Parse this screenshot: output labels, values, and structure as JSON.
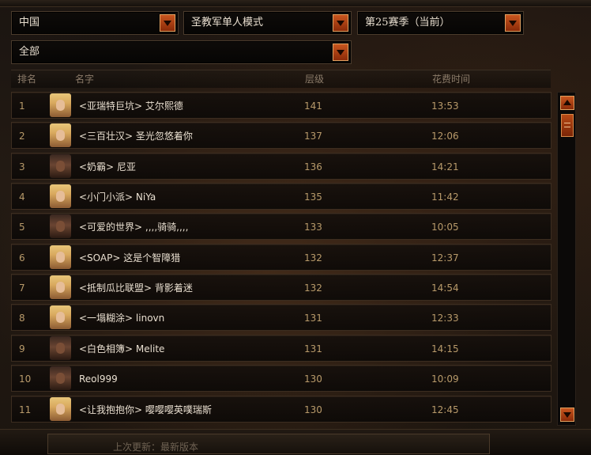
{
  "filters": {
    "region": "中国",
    "mode": "圣教军单人模式",
    "season": "第25赛季（当前）",
    "category": "全部"
  },
  "table": {
    "columns": [
      "排名",
      "名字",
      "层级",
      "花费时间"
    ],
    "rows": [
      {
        "rank": "1",
        "name": "<亚瑞特巨坑> 艾尔熙德",
        "level": "141",
        "time": "13:53",
        "portrait": "female"
      },
      {
        "rank": "2",
        "name": "<三百壮汉> 圣光忽悠着你",
        "level": "137",
        "time": "12:06",
        "portrait": "female"
      },
      {
        "rank": "3",
        "name": "<奶霸> 尼亚",
        "level": "136",
        "time": "14:21",
        "portrait": "male"
      },
      {
        "rank": "4",
        "name": "<小门小派> NiYa",
        "level": "135",
        "time": "11:42",
        "portrait": "female"
      },
      {
        "rank": "5",
        "name": "<可爱的世界> ,,,,骑骑,,,,",
        "level": "133",
        "time": "10:05",
        "portrait": "male"
      },
      {
        "rank": "6",
        "name": "<SOAP> 这是个智障猎",
        "level": "132",
        "time": "12:37",
        "portrait": "female"
      },
      {
        "rank": "7",
        "name": "<抵制瓜比联盟> 背影着迷",
        "level": "132",
        "time": "14:54",
        "portrait": "female"
      },
      {
        "rank": "8",
        "name": "<一塌糊涂> linovn",
        "level": "131",
        "time": "12:33",
        "portrait": "female"
      },
      {
        "rank": "9",
        "name": "<白色相簿> Melite",
        "level": "131",
        "time": "14:15",
        "portrait": "male"
      },
      {
        "rank": "10",
        "name": "Reol999",
        "level": "130",
        "time": "10:09",
        "portrait": "male"
      },
      {
        "rank": "11",
        "name": "<让我抱抱你> 嘤嘤嘤英噗瑞斯",
        "level": "130",
        "time": "12:45",
        "portrait": "female"
      }
    ]
  },
  "footer": {
    "last_update": "上次更新：最新版本"
  },
  "colors": {
    "accent": "#c8561f",
    "text_primary": "#e9dfd0",
    "text_value": "#b89a6a",
    "header_text": "#8b7b69"
  }
}
